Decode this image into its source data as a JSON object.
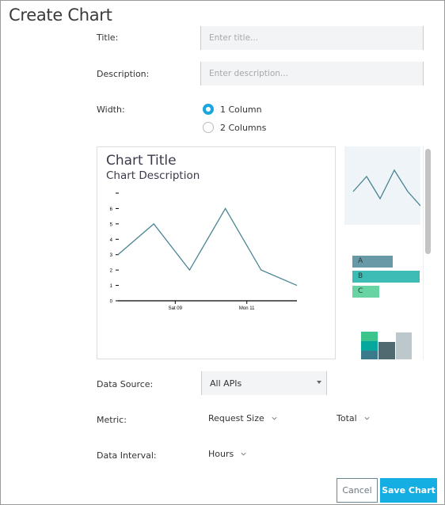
{
  "page": {
    "title": "Create Chart"
  },
  "form": {
    "title_label": "Title:",
    "title_placeholder": "Enter title...",
    "title_value": "",
    "description_label": "Description:",
    "description_placeholder": "Enter description...",
    "description_value": "",
    "width_label": "Width:",
    "width_options": [
      {
        "label": "1 Column",
        "checked": true
      },
      {
        "label": "2 Columns",
        "checked": false
      }
    ],
    "data_source_label": "Data Source:",
    "data_source_value": "All APIs",
    "metric_label": "Metric:",
    "metric_value": "Request Size",
    "aggregation_value": "Total",
    "interval_label": "Data Interval:",
    "interval_value": "Hours"
  },
  "preview": {
    "title": "Chart Title",
    "description": "Chart Description"
  },
  "chart_types": [
    {
      "name": "line",
      "selected": true
    },
    {
      "name": "horizontal-bar",
      "selected": false,
      "labels": [
        "A",
        "B",
        "C"
      ]
    },
    {
      "name": "stacked-bar",
      "selected": false
    }
  ],
  "colors": {
    "accent": "#14aee3",
    "line": "#4a8493",
    "bar_a": "#6899a7",
    "bar_b": "#3dbbb5",
    "bar_c": "#68d4a4",
    "stack_top": "#3cc48c",
    "stack_mid": "#06a89e",
    "stack_bottom": "#3a7a8a",
    "stack_dark": "#4f6a71",
    "stack_light": "#bdc8cc"
  },
  "buttons": {
    "cancel": "Cancel",
    "save": "Save Chart"
  },
  "chart_data": {
    "type": "line",
    "title": "Chart Title",
    "subtitle": "Chart Description",
    "x": [
      0,
      1,
      2,
      3,
      4,
      5
    ],
    "values": [
      3,
      5,
      2,
      6,
      2,
      1
    ],
    "xtick_labels": [
      "Sat 09",
      "Mon 11"
    ],
    "xtick_positions": [
      1.6,
      3.6
    ],
    "yticks": [
      0,
      1,
      2,
      3,
      4,
      5,
      6
    ],
    "ylim": [
      0,
      7
    ],
    "xlabel": "",
    "ylabel": "",
    "grid": false,
    "legend": "none"
  }
}
